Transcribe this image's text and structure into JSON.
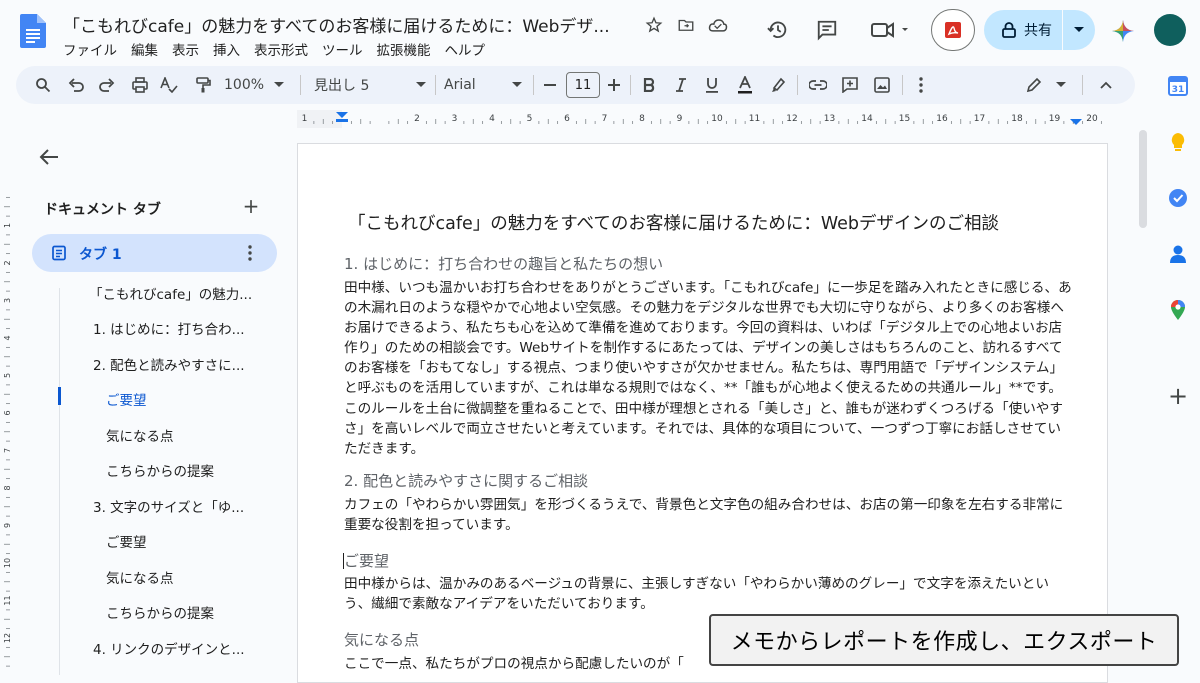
{
  "header": {
    "title": "「こもれびcafe」の魅力をすべてのお客様に届けるために：Webデザ...",
    "menu": [
      "ファイル",
      "編集",
      "表示",
      "挿入",
      "表示形式",
      "ツール",
      "拡張機能",
      "ヘルプ"
    ],
    "share_label": "共有"
  },
  "toolbar": {
    "zoom": "100%",
    "style": "見出し 5",
    "font": "Arial",
    "font_size": "11"
  },
  "ruler": {
    "labels": [
      "1",
      "1",
      "2",
      "3",
      "4",
      "5",
      "6",
      "7",
      "8",
      "9",
      "10",
      "11",
      "12",
      "13",
      "14",
      "15",
      "16",
      "17",
      "18",
      "19",
      "20"
    ]
  },
  "vruler": {
    "labels": [
      "1",
      "2",
      "3",
      "4",
      "5",
      "6",
      "7",
      "8",
      "9",
      "10",
      "11",
      "12",
      "13"
    ]
  },
  "sidebar": {
    "heading": "ドキュメント タブ",
    "tab_label": "タブ 1",
    "outline": [
      "「こもれびcafe」の魅力...",
      "1. はじめに：打ち合わ...",
      "2. 配色と読みやすさに...",
      "ご要望",
      "気になる点",
      "こちらからの提案",
      "3. 文字のサイズと「ゆ...",
      "ご要望",
      "気になる点",
      "こちらからの提案",
      "4. リンクのデザインと..."
    ]
  },
  "document": {
    "title": "「こもれびcafe」の魅力をすべてのお客様に届けるために：Webデザインのご相談",
    "h1": "1. はじめに：打ち合わせの趣旨と私たちの想い",
    "p1": "田中様、いつも温かいお打ち合わせをありがとうございます。「こもれびcafe」に一歩足を踏み入れたときに感じる、あの木漏れ日のような穏やかで心地よい空気感。その魅力をデジタルな世界でも大切に守りながら、より多くのお客様へお届けできるよう、私たちも心を込めて準備を進めております。今回の資料は、いわば「デジタル上での心地よいお店作り」のための相談会です。Webサイトを制作するにあたっては、デザインの美しさはもちろんのこと、訪れるすべてのお客様を「おもてなし」する視点、つまり使いやすさが欠かせません。私たちは、専門用語で「デザインシステム」と呼ぶものを活用していますが、これは単なる規則ではなく、**「誰もが心地よく使えるための共通ルール」**です。このルールを土台に微調整を重ねることで、田中様が理想とされる「美しさ」と、誰もが迷わずくつろげる「使いやすさ」を高いレベルで両立させたいと考えています。それでは、具体的な項目について、一つずつ丁寧にお話しさせていただきます。",
    "h2": "2. 配色と読みやすさに関するご相談",
    "p2": "カフェの「やわらかい雰囲気」を形づくるうえで、背景色と文字色の組み合わせは、お店の第一印象を左右する非常に重要な役割を担っています。",
    "h3": "ご要望",
    "p3": "田中様からは、温かみのあるベージュの背景に、主張しすぎない「やわらかい薄めのグレー」で文字を添えたいという、繊細で素敵なアイデアをいただいております。",
    "h4": "気になる点",
    "p4": "ここで一点、私たちがプロの視点から配慮したいのが「"
  },
  "caption": "メモからレポートを作成し、エクスポート"
}
